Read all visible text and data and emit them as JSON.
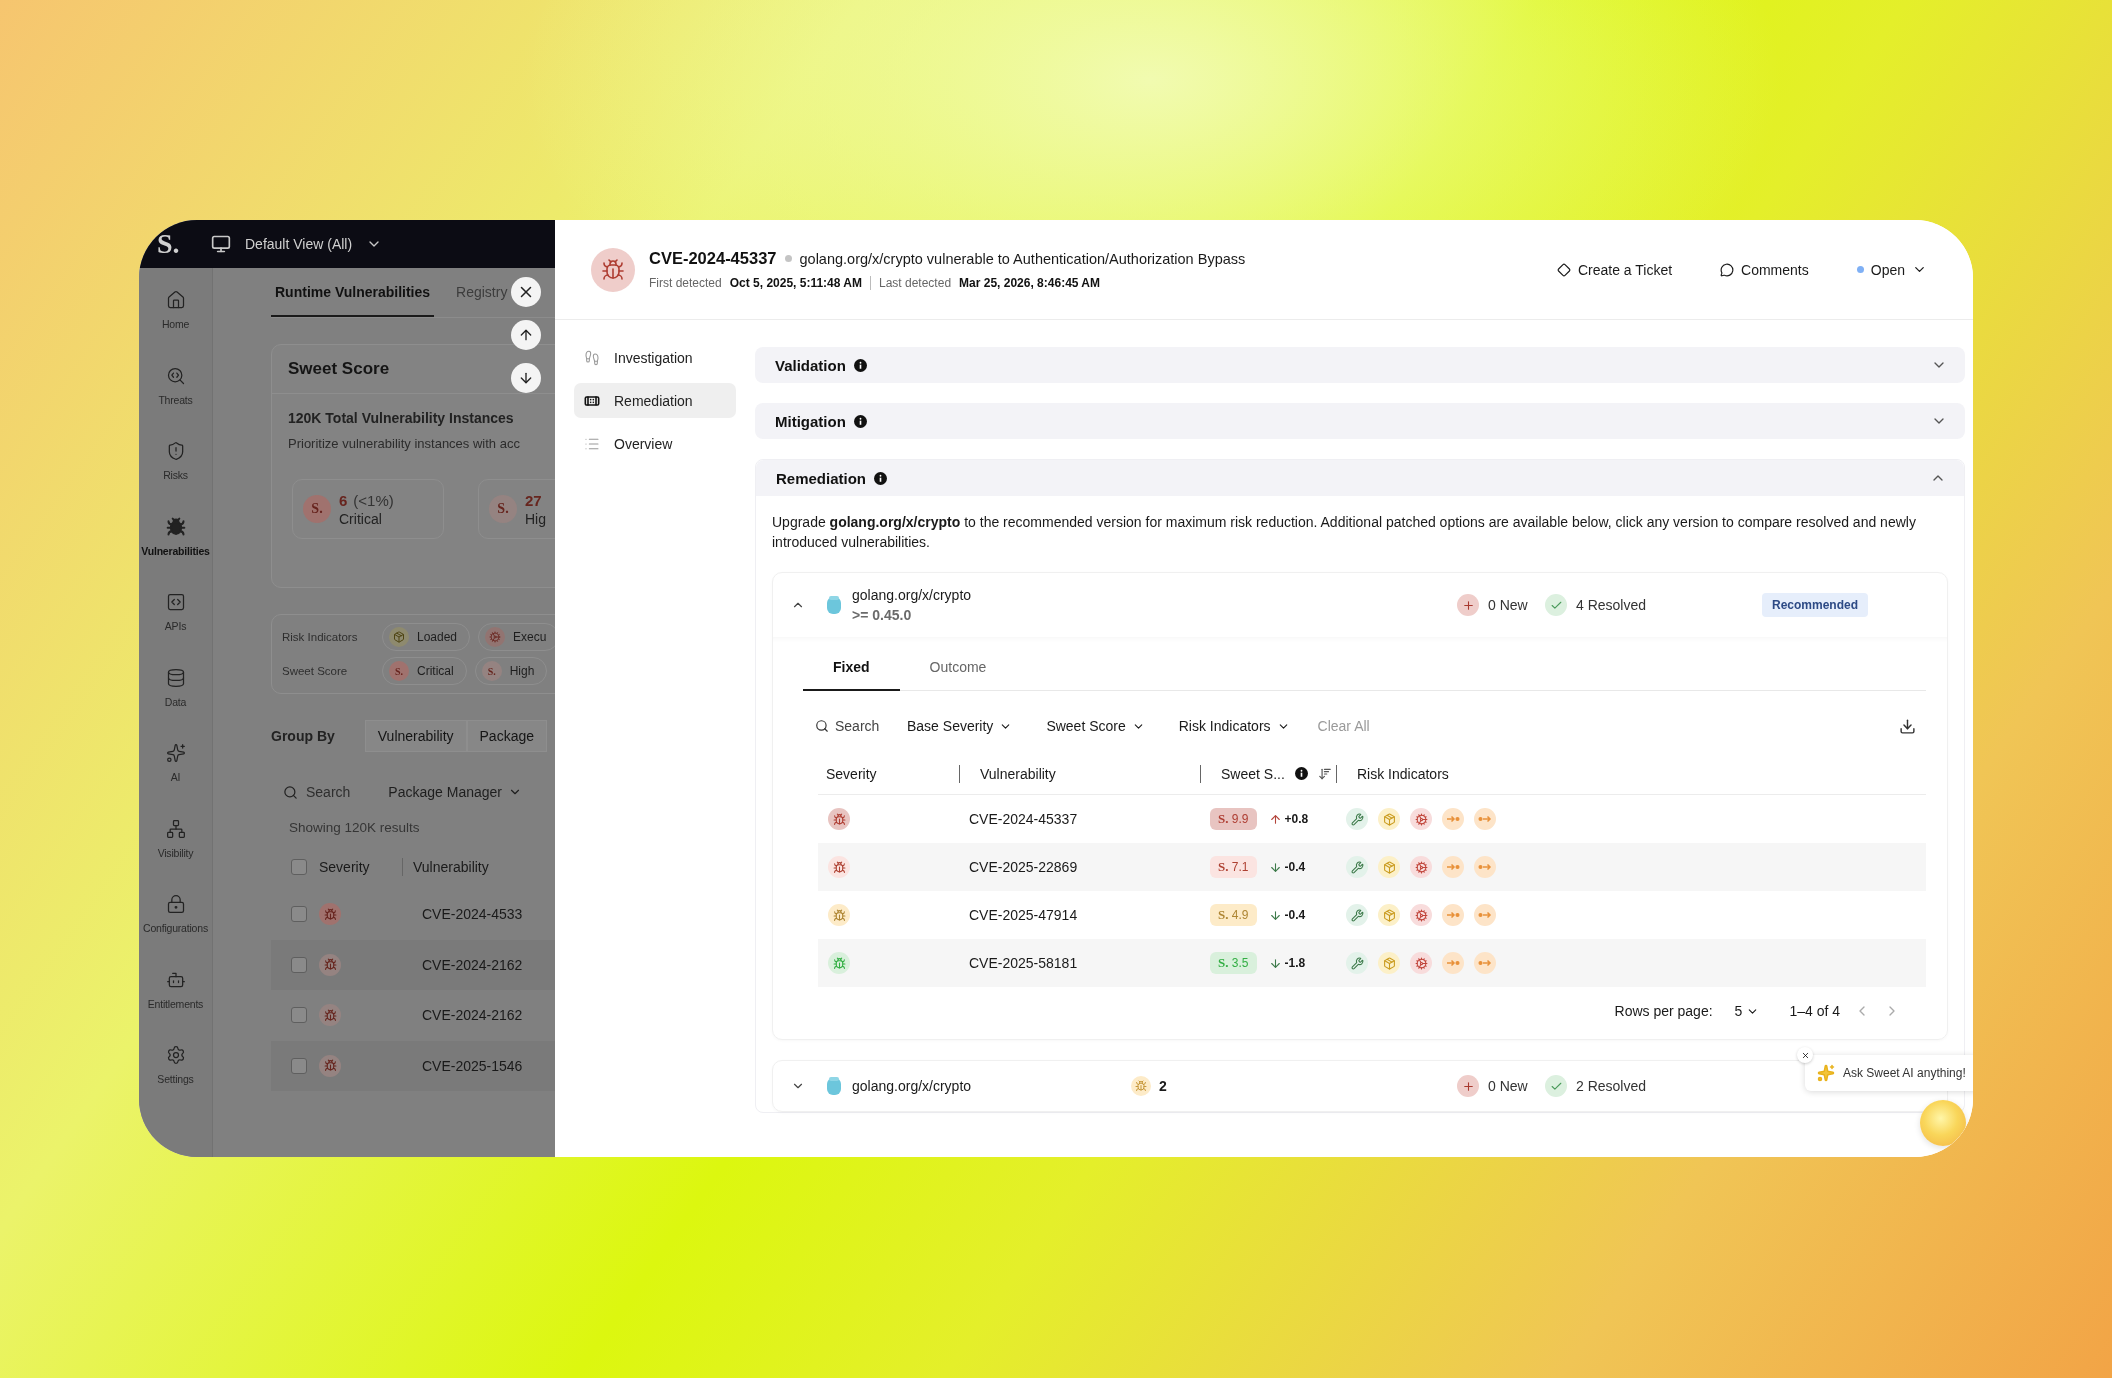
{
  "background_app": {
    "top_bar": {
      "logo": "S.",
      "view": "Default View (All)"
    },
    "nav": [
      {
        "label": "Home",
        "kind": "home",
        "selected": false
      },
      {
        "label": "Threats",
        "kind": "threats",
        "selected": false
      },
      {
        "label": "Risks",
        "kind": "risks",
        "selected": false
      },
      {
        "label": "Vulnerabilities",
        "kind": "vulnerabilities",
        "selected": true
      },
      {
        "label": "APIs",
        "kind": "apis",
        "selected": false
      },
      {
        "label": "Data",
        "kind": "data",
        "selected": false
      },
      {
        "label": "AI",
        "kind": "ai",
        "selected": false
      },
      {
        "label": "Visibility",
        "kind": "visibility",
        "selected": false
      },
      {
        "label": "Configurations",
        "kind": "configurations",
        "selected": false
      },
      {
        "label": "Entitlements",
        "kind": "entitlements",
        "selected": false
      },
      {
        "label": "Settings",
        "kind": "settings",
        "selected": false
      }
    ],
    "tabs": [
      {
        "label": "Runtime Vulnerabilities",
        "selected": true
      },
      {
        "label": "Registry",
        "selected": false
      }
    ],
    "score_card": {
      "title": "Sweet Score",
      "heading": "120K Total Vulnerability Instances",
      "description": "Prioritize vulnerability instances with acc",
      "tiles": [
        {
          "mark": "S.",
          "count": "6",
          "share": "(<1%)",
          "label": "Critical",
          "color": "#a0726e"
        },
        {
          "mark": "S.",
          "count": "27",
          "label": "Hig",
          "color": "#958381"
        }
      ]
    },
    "filters": [
      {
        "label": "Risk Indicators",
        "chips": [
          {
            "kind": "loaded",
            "label": "Loaded"
          },
          {
            "kind": "executed",
            "label": "Execu"
          }
        ]
      },
      {
        "label": "Sweet Score",
        "chips": [
          {
            "kind": "score",
            "mark": "S.",
            "label": "Critical",
            "color": "#a0726e"
          },
          {
            "kind": "score",
            "mark": "S.",
            "label": "High",
            "color": "#958381"
          }
        ]
      }
    ],
    "group_by": {
      "label": "Group By",
      "options": [
        "Vulnerability",
        "Package"
      ]
    },
    "search": {
      "placeholder": "Search"
    },
    "package_manager": "Package Manager",
    "results": "Showing 120K results",
    "table": {
      "all_checked": false,
      "columns": [
        "Severity",
        "Vulnerability"
      ],
      "rows": [
        {
          "checked": false,
          "color": "#a0726e",
          "id": "CVE-2024-4533"
        },
        {
          "checked": false,
          "color": "#958381",
          "id": "CVE-2024-2162"
        },
        {
          "checked": false,
          "color": "#958381",
          "id": "CVE-2024-2162"
        },
        {
          "checked": false,
          "color": "#958381",
          "id": "CVE-2025-1546"
        }
      ]
    }
  },
  "drawer": {
    "header": {
      "color": "#efcdca",
      "id": "CVE-2024-45337",
      "title": "golang.org/x/crypto vulnerable to Authentication/Authorization Bypass",
      "first_detected_label": "First detected",
      "first_detected": "Oct 5, 2025, 5:11:48 AM",
      "last_detected_label": "Last detected",
      "last_detected": "Mar 25, 2026, 8:46:45 AM",
      "actions": [
        {
          "kind": "ticket",
          "label": "Create a Ticket"
        },
        {
          "kind": "comments",
          "label": "Comments"
        }
      ],
      "status": {
        "label": "Open",
        "color": "#7fb0f5"
      }
    },
    "nav": [
      {
        "kind": "investigation",
        "label": "Investigation",
        "selected": false
      },
      {
        "kind": "remediation",
        "label": "Remediation",
        "selected": true
      },
      {
        "kind": "overview",
        "label": "Overview",
        "selected": false
      }
    ],
    "sections": [
      {
        "title": "Validation",
        "expanded": false
      },
      {
        "title": "Mitigation",
        "expanded": false
      },
      {
        "title": "Remediation",
        "expanded": true
      }
    ],
    "remediation": {
      "text": "Upgrade **golang.org/x/crypto** to the recommended version for maximum risk reduction. Additional patched options are available below, click any version to compare resolved and newly introduced vulnerabilities.",
      "packages": [
        {
          "name": "golang.org/x/crypto",
          "version": ">= 0.45.0",
          "expanded": true,
          "new": "0 New",
          "resolved": "4 Resolved",
          "badge": "Recommended",
          "tabs": [
            {
              "label": "Fixed",
              "selected": true
            },
            {
              "label": "Outcome",
              "selected": false
            }
          ],
          "search": {
            "placeholder": "Search"
          },
          "dropdowns": [
            "Base Severity",
            "Sweet Score",
            "Risk Indicators"
          ],
          "clear": "Clear All",
          "columns": [
            "Severity",
            "Vulnerability",
            "Sweet S...",
            "Risk Indicators"
          ],
          "rows": [
            {
              "color": "#e8c4c1",
              "id": "CVE-2024-45337",
              "score": "**S.** 9.9",
              "kind": "up",
              "delta": "+0.8"
            },
            {
              "color": "#fbe4e1",
              "id": "CVE-2025-22869",
              "score": "**S.** 7.1",
              "kind": "down",
              "delta": "-0.4"
            },
            {
              "color": "#fdebc8",
              "id": "CVE-2025-47914",
              "score": "**S.** 4.9",
              "kind": "down",
              "delta": "-0.4"
            },
            {
              "color": "#d9f0dc",
              "id": "CVE-2025-58181",
              "score": "**S.** 3.5",
              "kind": "down",
              "delta": "-1.8"
            }
          ],
          "pagination": {
            "rows_label": "Rows per page:",
            "rows_value": "5",
            "range": "1–4 of 4"
          }
        },
        {
          "name": "golang.org/x/crypto",
          "expanded": false,
          "count": "2",
          "new": "0 New",
          "resolved": "2 Resolved"
        }
      ]
    },
    "assistant": {
      "prompt": "Ask Sweet AI anything!"
    }
  }
}
